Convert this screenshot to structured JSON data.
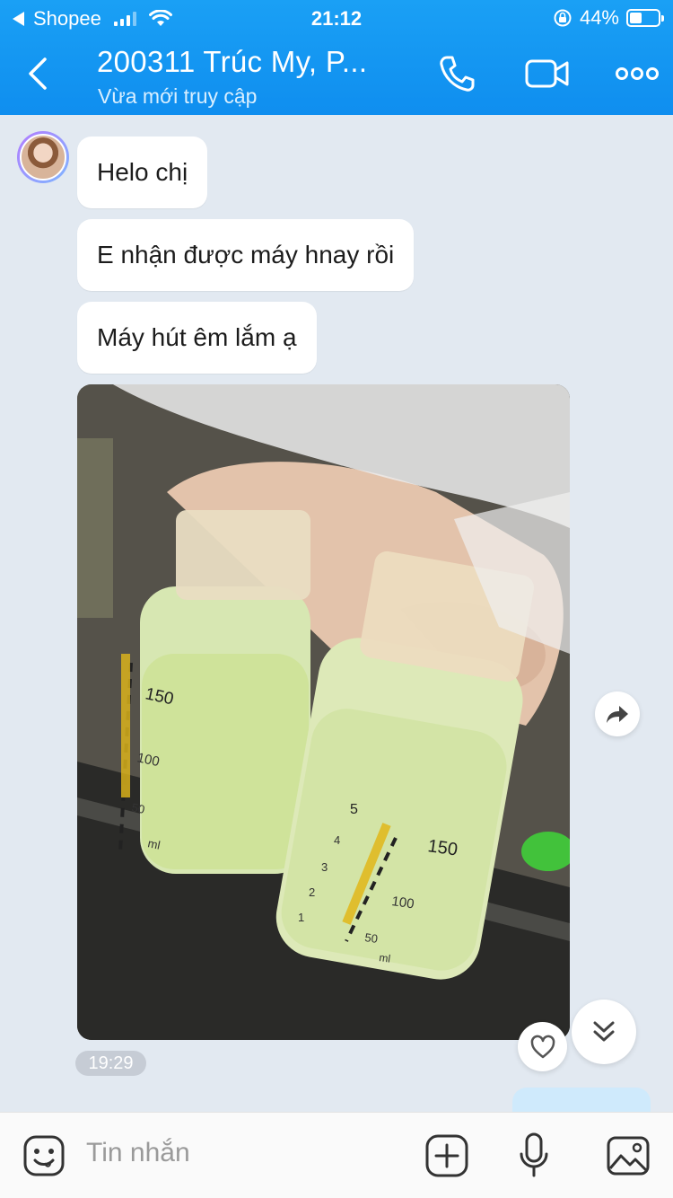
{
  "status_bar": {
    "carrier": "Shopee",
    "time": "21:12",
    "battery": "44%",
    "battery_level": 0.44
  },
  "header": {
    "title": "200311 Trúc My, P...",
    "subtitle": "Vừa mới truy cập",
    "icons": [
      "back-icon",
      "phone-icon",
      "video-call-icon",
      "more-icon"
    ]
  },
  "messages": [
    {
      "text": "Helo chị"
    },
    {
      "text": "E nhận được máy hnay rồi"
    },
    {
      "text": "Máy hút êm lắm ạ"
    }
  ],
  "photo_message": {
    "bottle_marks_left": [
      "150",
      "100",
      "50",
      "ml"
    ],
    "bottle_marks_right": [
      "5",
      "4",
      "3",
      "2",
      "1",
      "150",
      "100",
      "50",
      "ml"
    ],
    "time": "19:29"
  },
  "input": {
    "placeholder": "Tin nhắn",
    "icons": [
      "emoji-icon",
      "add-icon",
      "microphone-icon",
      "image-icon"
    ]
  }
}
